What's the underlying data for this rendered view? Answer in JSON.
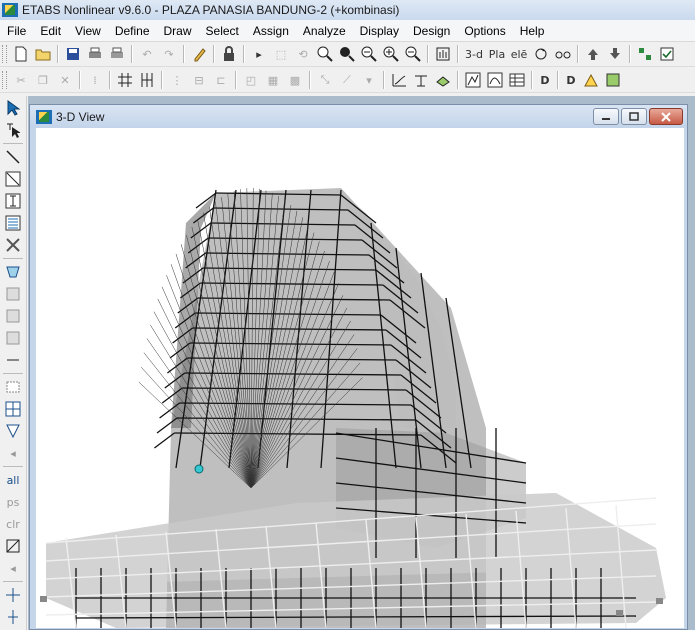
{
  "app": {
    "title": "ETABS Nonlinear v9.6.0 - PLAZA PANASIA BANDUNG-2 (+kombinasi)",
    "accent": "#1c6fb5"
  },
  "menu": [
    {
      "label": "File"
    },
    {
      "label": "Edit"
    },
    {
      "label": "View"
    },
    {
      "label": "Define"
    },
    {
      "label": "Draw"
    },
    {
      "label": "Select"
    },
    {
      "label": "Assign"
    },
    {
      "label": "Analyze"
    },
    {
      "label": "Display"
    },
    {
      "label": "Design"
    },
    {
      "label": "Options"
    },
    {
      "label": "Help"
    }
  ],
  "toolbar1": {
    "view_3d_label": "3-d",
    "plan_label": "Pla",
    "elev_label": "elē"
  },
  "toolbar2": {
    "label_d1": "D",
    "label_d2": "D"
  },
  "sidebar": {
    "all_label": "all",
    "ps_label": "ps",
    "clr_label": "clr"
  },
  "window": {
    "title": "3-D View",
    "minimize_icon": "minimize-icon",
    "maximize_icon": "maximize-icon",
    "close_icon": "close-icon"
  }
}
